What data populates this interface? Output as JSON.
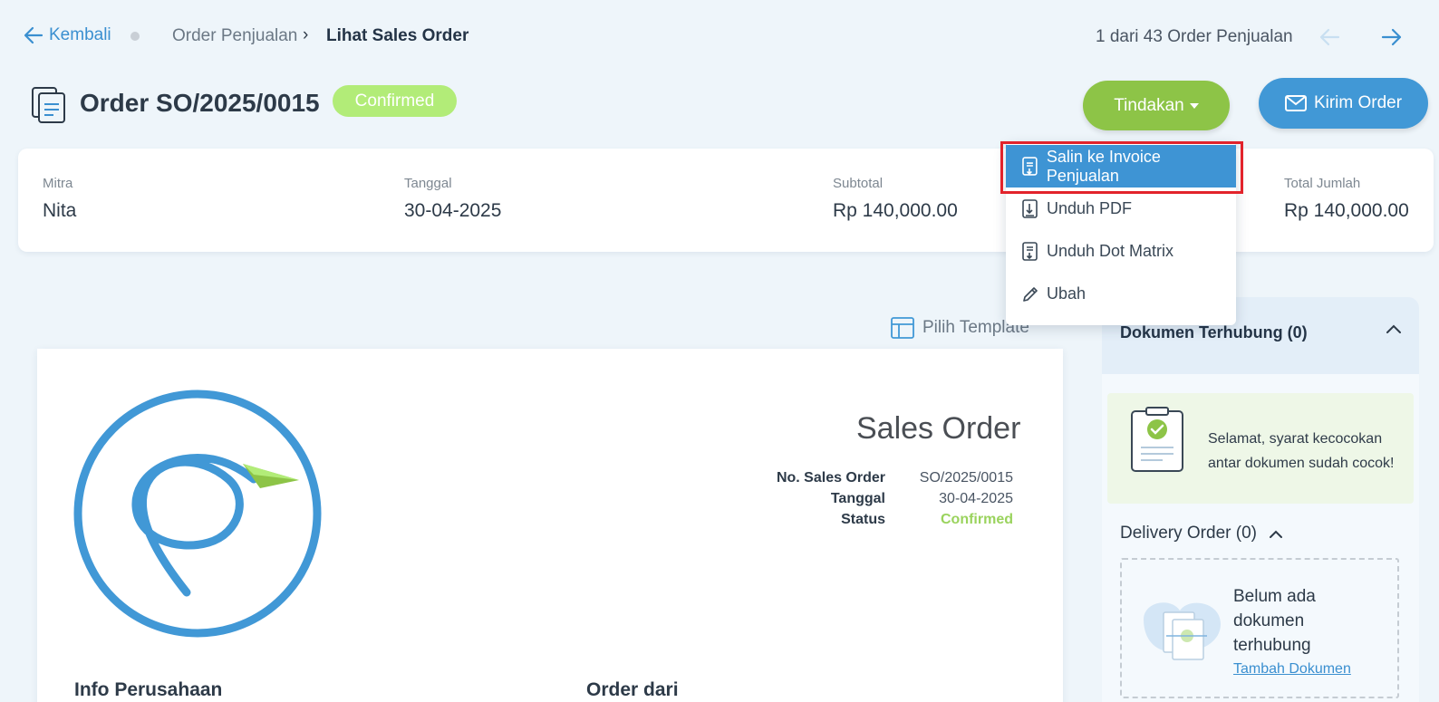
{
  "nav": {
    "back_label": "Kembali",
    "breadcrumb_parent": "Order Penjualan",
    "breadcrumb_separator": "›",
    "breadcrumb_current": "Lihat Sales Order",
    "pager_text": "1 dari 43 Order Penjualan"
  },
  "header": {
    "title": "Order SO/2025/0015",
    "status_badge": "Confirmed",
    "actions_label": "Tindakan",
    "send_label": "Kirim Order"
  },
  "summary": {
    "partner_label": "Mitra",
    "partner_value": "Nita",
    "date_label": "Tanggal",
    "date_value": "30-04-2025",
    "subtotal_label": "Subtotal",
    "subtotal_value": "Rp 140,000.00",
    "total_label": "Total Jumlah",
    "total_value": "Rp 140,000.00"
  },
  "dropdown": {
    "items": [
      {
        "label": "Salin ke Invoice Penjualan",
        "icon": "copy-invoice-icon"
      },
      {
        "label": "Unduh PDF",
        "icon": "pdf-download-icon"
      },
      {
        "label": "Unduh Dot Matrix",
        "icon": "dot-matrix-download-icon"
      },
      {
        "label": "Ubah",
        "icon": "pencil-icon"
      }
    ]
  },
  "template": {
    "label": "Pilih Template"
  },
  "document": {
    "title": "Sales Order",
    "no_label": "No. Sales Order",
    "no_value": "SO/2025/0015",
    "date_label": "Tanggal",
    "date_value": "30-04-2025",
    "status_label": "Status",
    "status_value": "Confirmed",
    "company_info_heading": "Info Perusahaan",
    "order_from_heading": "Order dari"
  },
  "linked_docs": {
    "title": "Dokumen Terhubung (0)",
    "match_message": "Selamat, syarat kecocokan antar dokumen sudah cocok!",
    "delivery_title": "Delivery Order (0)",
    "empty_text": "Belum ada dokumen terhubung",
    "add_link": "Tambah Dokumen"
  },
  "colors": {
    "primary": "#4198d6",
    "action_green": "#8dc447",
    "badge_green": "#b2ec78",
    "status_green": "#9ad35d",
    "highlight_red": "#e2232b"
  }
}
